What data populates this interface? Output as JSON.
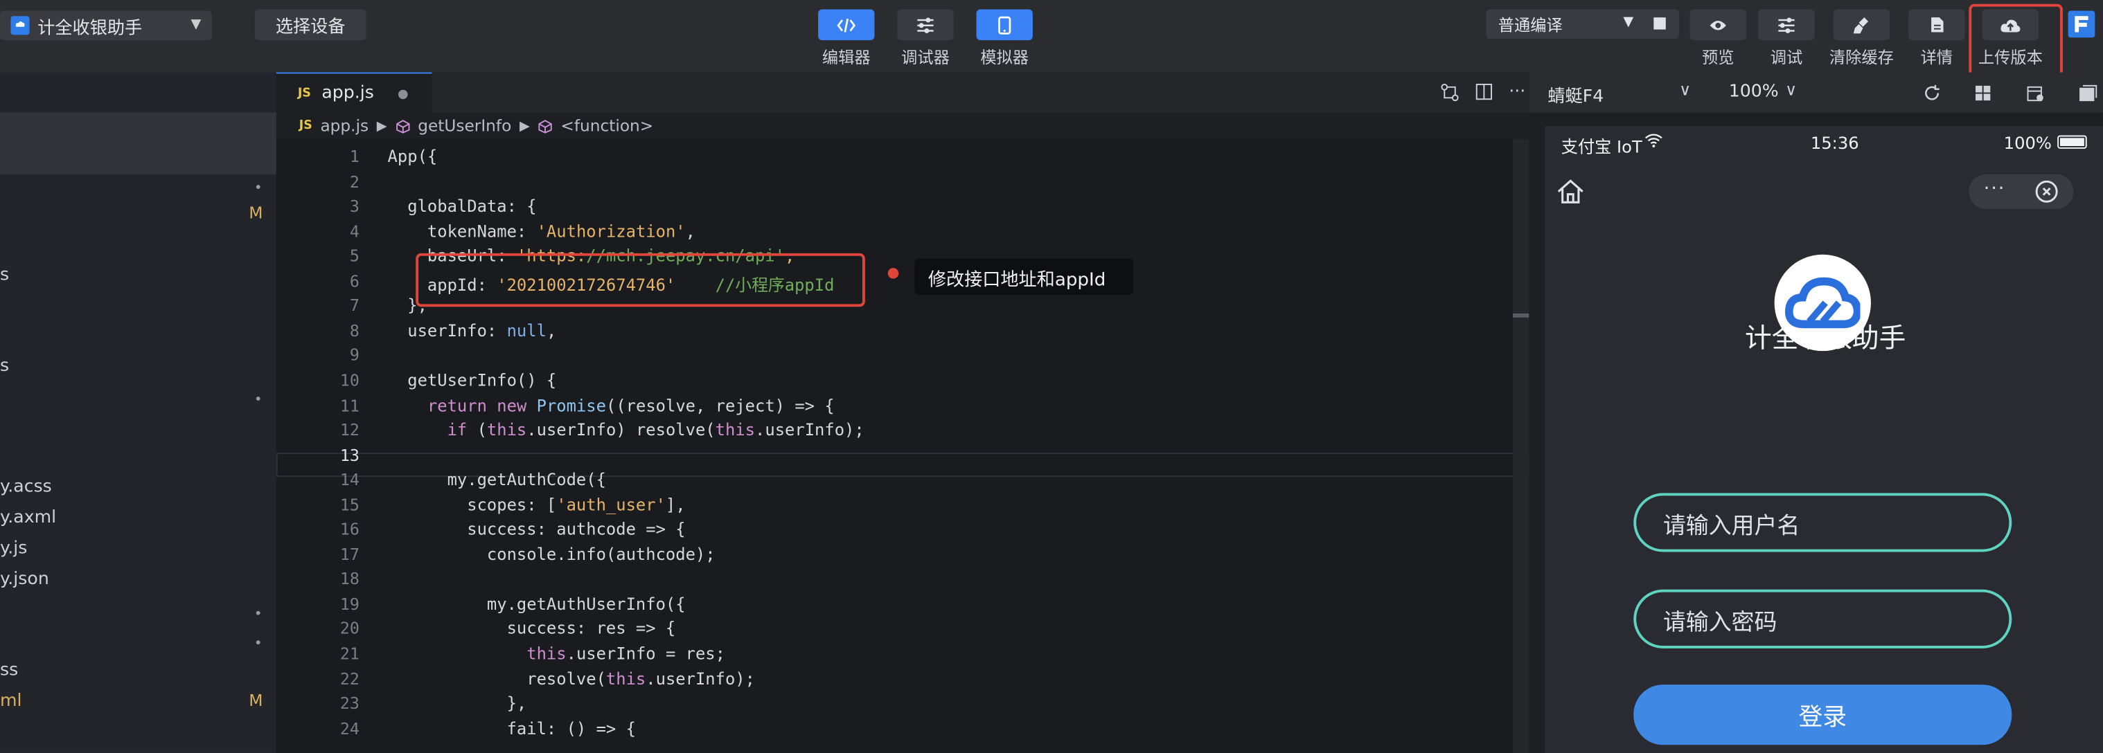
{
  "toolbar": {
    "project_name": "计全收银助手",
    "select_device": "选择设备",
    "center_buttons": [
      {
        "label": "编辑器",
        "icon": "code-icon"
      },
      {
        "label": "调试器",
        "icon": "sliders-icon"
      },
      {
        "label": "模拟器",
        "icon": "phone-icon"
      }
    ],
    "compile_mode": "普通编译",
    "right_buttons": [
      {
        "label": "预览",
        "icon": "eye-icon"
      },
      {
        "label": "调试",
        "icon": "sliders-icon"
      },
      {
        "label": "清除缓存",
        "icon": "broom-icon"
      },
      {
        "label": "详情",
        "icon": "document-icon"
      },
      {
        "label": "上传版本",
        "icon": "cloud-upload-icon"
      }
    ]
  },
  "sidebar": {
    "items": [
      {
        "text": "s"
      },
      {
        "text": "s"
      },
      {
        "text": "y.acss"
      },
      {
        "text": "y.axml"
      },
      {
        "text": "y.js"
      },
      {
        "text": "y.json"
      },
      {
        "text": "ss"
      },
      {
        "text": "ml"
      }
    ],
    "badges": [
      "M",
      "M"
    ]
  },
  "editor": {
    "tab_name": "app.js",
    "tab_type": "JS",
    "breadcrumb": [
      "app.js",
      "getUserInfo",
      "<function>"
    ],
    "line_numbers": [
      "1",
      "2",
      "3",
      "4",
      "5",
      "6",
      "7",
      "8",
      "9",
      "10",
      "11",
      "12",
      "13",
      "14",
      "15",
      "16",
      "17",
      "18",
      "19",
      "20",
      "21",
      "22",
      "23",
      "24"
    ],
    "code_lines": [
      "App({",
      "",
      "  globalData: {",
      "    tokenName: 'Authorization',",
      "    baseUrl: 'https://mch.jeepay.cn/api',",
      "    appId: '2021002172674746'    //小程序appId",
      "  },",
      "  userInfo: null,",
      "",
      "  getUserInfo() {",
      "    return new Promise((resolve, reject) => {",
      "      if (this.userInfo) resolve(this.userInfo);",
      "",
      "      my.getAuthCode({",
      "        scopes: ['auth_user'],",
      "        success: authcode => {",
      "          console.info(authcode);",
      "",
      "          my.getAuthUserInfo({",
      "            success: res => {",
      "              this.userInfo = res;",
      "              resolve(this.userInfo);",
      "            },",
      "            fail: () => {"
    ],
    "annotation": "修改接口地址和appId"
  },
  "simulator": {
    "device": "蜻蜓F4",
    "zoom": "100%",
    "carrier": "支付宝 IoT",
    "time": "15:36",
    "battery": "100%",
    "app_title": "计全收银助手",
    "username_placeholder": "请输入用户名",
    "password_placeholder": "请输入密码",
    "login_label": "登录"
  },
  "colors": {
    "accent": "#3b82f6",
    "highlight_red": "#e0453b",
    "input_border": "#5fd3c2",
    "login_button": "#3f88e4"
  }
}
